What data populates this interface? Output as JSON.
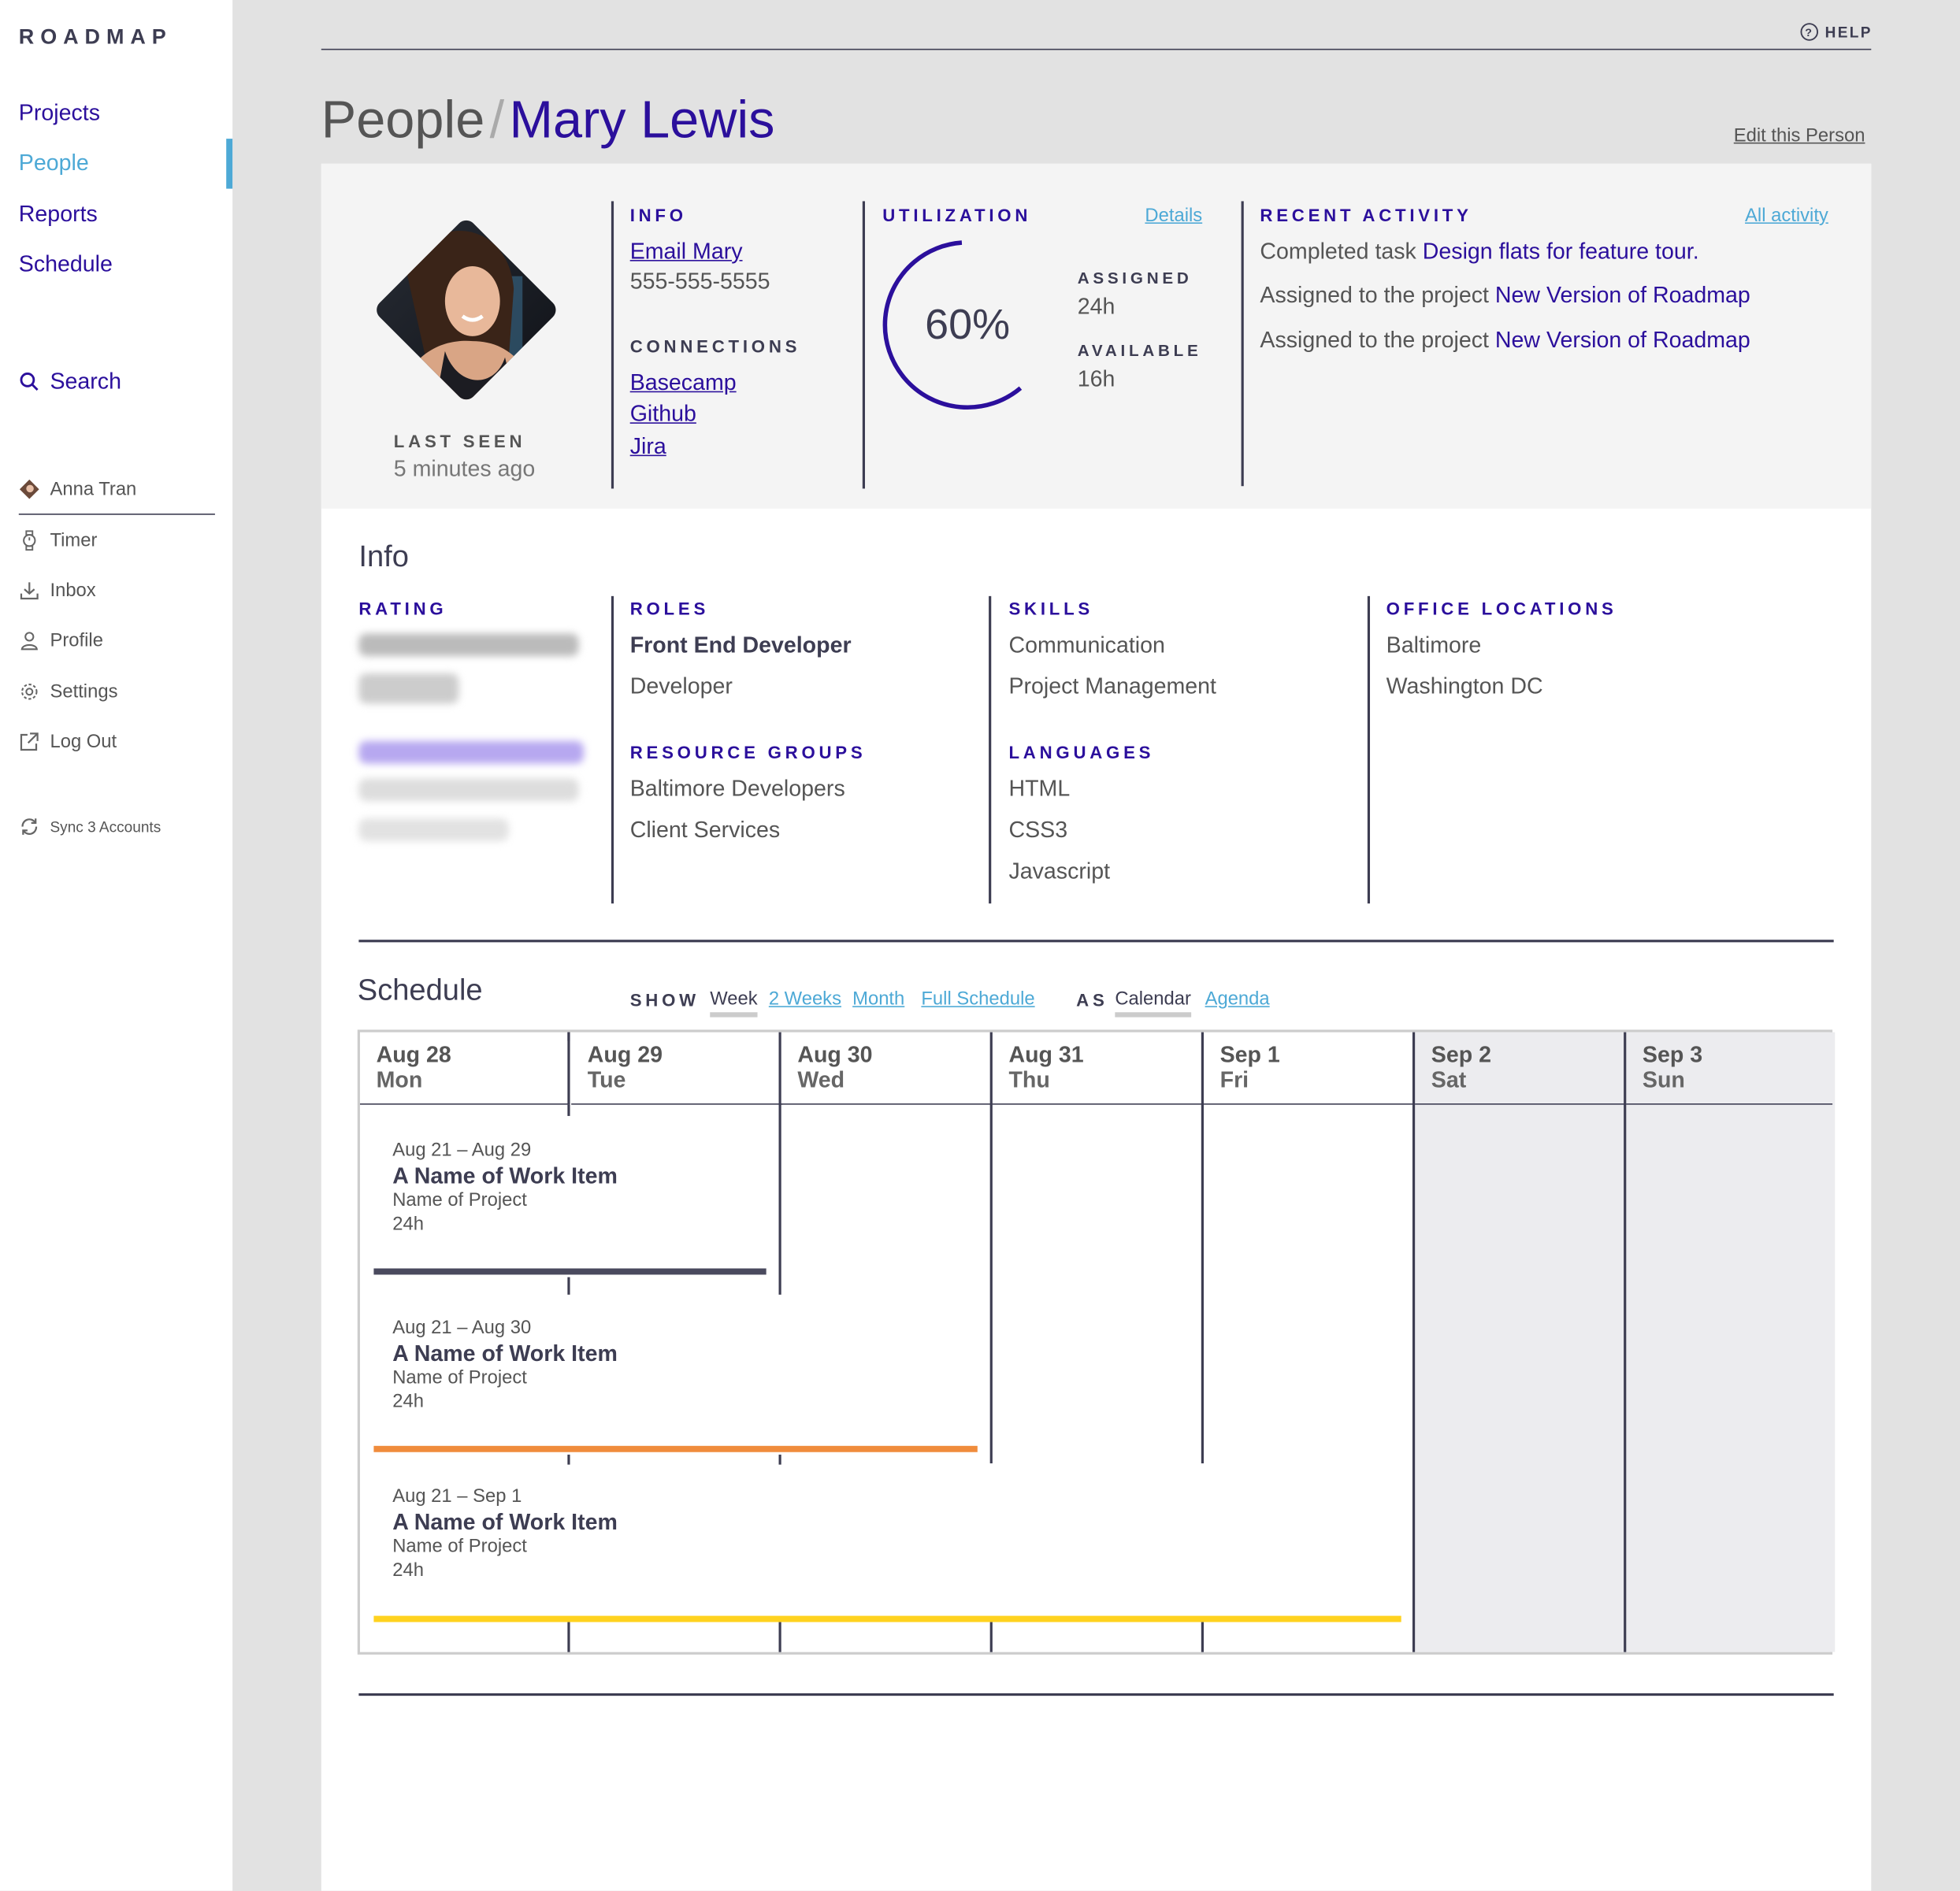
{
  "app": {
    "logo": "ROADMAP",
    "help": "HELP"
  },
  "nav": {
    "projects": "Projects",
    "people": "People",
    "reports": "Reports",
    "schedule": "Schedule",
    "search": "Search"
  },
  "user_menu": {
    "user": "Anna Tran",
    "timer": "Timer",
    "inbox": "Inbox",
    "profile": "Profile",
    "settings": "Settings",
    "logout": "Log Out",
    "sync": "Sync 3 Accounts"
  },
  "breadcrumb": {
    "parent": "People",
    "separator": "/",
    "current": "Mary Lewis"
  },
  "edit_link": "Edit this Person",
  "profile": {
    "last_seen_label": "LAST SEEN",
    "last_seen_value": "5 minutes ago",
    "info_label": "INFO",
    "email_link": "Email Mary",
    "phone": "555-555-5555",
    "connections_label": "CONNECTIONS",
    "connections": [
      "Basecamp",
      "Github",
      "Jira"
    ]
  },
  "utilization": {
    "label": "UTILIZATION",
    "details_link": "Details",
    "percent_text": "60%",
    "percent_value": 0.6,
    "assigned_label": "ASSIGNED",
    "assigned_value": "24h",
    "available_label": "AVAILABLE",
    "available_value": "16h",
    "ring_color": "#2b0f9c"
  },
  "activity": {
    "label": "RECENT ACTIVITY",
    "all_link": "All activity",
    "items": [
      {
        "text": "Completed task",
        "link": "Design flats for feature tour."
      },
      {
        "text": "Assigned to the project",
        "link": "New Version of Roadmap"
      },
      {
        "text": "Assigned to the project",
        "link": "New Version of Roadmap"
      }
    ]
  },
  "info": {
    "title": "Info",
    "rating_label": "RATING",
    "roles_label": "ROLES",
    "roles": [
      "Front End Developer",
      "Developer"
    ],
    "resource_groups_label": "RESOURCE GROUPS",
    "resource_groups": [
      "Baltimore Developers",
      "Client Services"
    ],
    "skills_label": "SKILLS",
    "skills": [
      "Communication",
      "Project Management"
    ],
    "languages_label": "LANGUAGES",
    "languages": [
      "HTML",
      "CSS3",
      "Javascript"
    ],
    "office_label": "OFFICE LOCATIONS",
    "offices": [
      "Baltimore",
      "Washington DC"
    ]
  },
  "schedule": {
    "title": "Schedule",
    "show_label": "SHOW",
    "show_options": [
      "Week",
      "2 Weeks",
      "Month",
      "Full Schedule"
    ],
    "show_selected": "Week",
    "as_label": "AS",
    "as_options": [
      "Calendar",
      "Agenda"
    ],
    "as_selected": "Calendar",
    "days": [
      {
        "date": "Aug 28",
        "day": "Mon"
      },
      {
        "date": "Aug 29",
        "day": "Tue"
      },
      {
        "date": "Aug 30",
        "day": "Wed"
      },
      {
        "date": "Aug 31",
        "day": "Thu"
      },
      {
        "date": "Sep 1",
        "day": "Fri"
      },
      {
        "date": "Sep 2",
        "day": "Sat"
      },
      {
        "date": "Sep 3",
        "day": "Sun"
      }
    ],
    "items": [
      {
        "range": "Aug 21 – Aug 29",
        "title": "A Name of Work Item",
        "project": "Name of Project",
        "hours": "24h",
        "color": "#4a4a5e"
      },
      {
        "range": "Aug 21 – Aug 30",
        "title": "A Name of Work Item",
        "project": "Name of Project",
        "hours": "24h",
        "color": "#f08c3c"
      },
      {
        "range": "Aug 21 – Sep 1",
        "title": "A Name of Work Item",
        "project": "Name of Project",
        "hours": "24h",
        "color": "#ffd21f"
      }
    ]
  },
  "colors": {
    "accent": "#2b0f9c",
    "active_nav": "#4da9d6",
    "text": "#3d3d52"
  }
}
